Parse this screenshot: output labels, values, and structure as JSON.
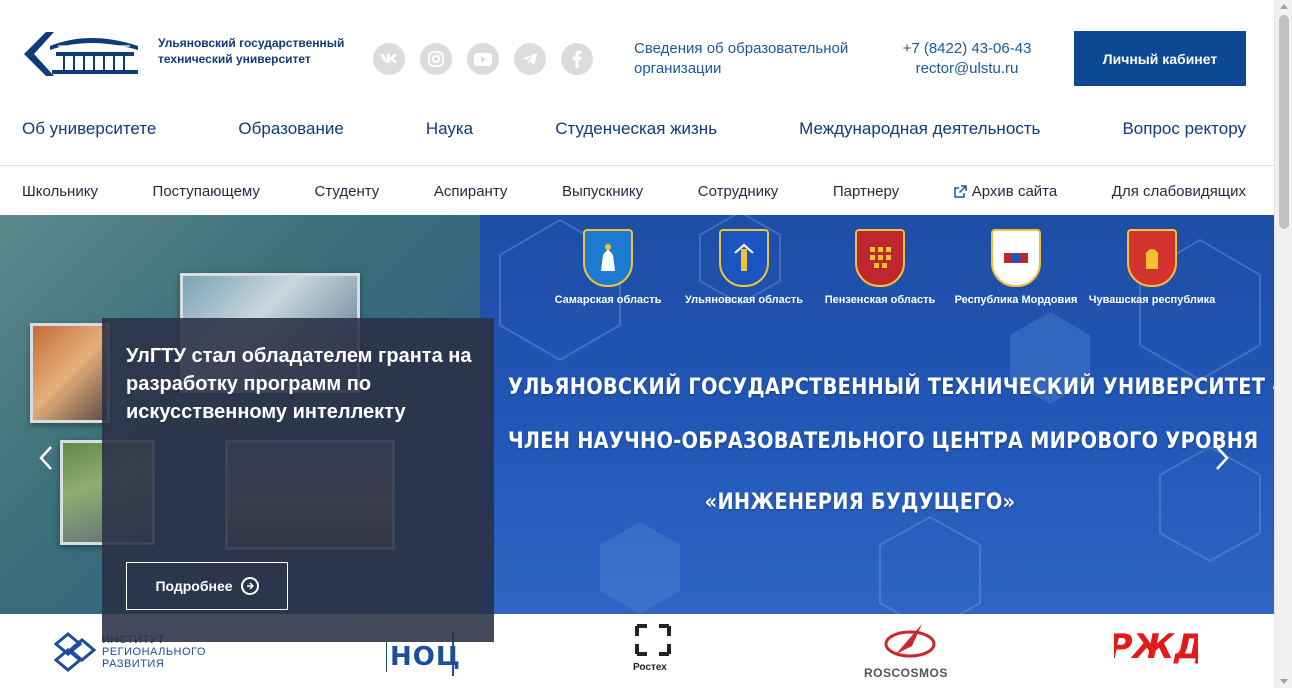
{
  "header": {
    "university_name": "Ульяновский государственный технический университет",
    "svedeniya_link": "Сведения об образовательной организации",
    "phone": "+7 (8422) 43-06-43",
    "email": "rector@ulstu.ru",
    "cabinet_button": "Личный кабинет",
    "socials": [
      "vk-icon",
      "instagram-icon",
      "youtube-icon",
      "telegram-icon",
      "facebook-icon"
    ]
  },
  "main_nav": [
    {
      "label": "Об университете"
    },
    {
      "label": "Образование"
    },
    {
      "label": "Наука"
    },
    {
      "label": "Студенческая жизнь"
    },
    {
      "label": "Международная деятельность"
    },
    {
      "label": "Вопрос ректору"
    }
  ],
  "sub_nav": [
    {
      "label": "Школьнику"
    },
    {
      "label": "Поступающему"
    },
    {
      "label": "Студенту"
    },
    {
      "label": "Аспиранту"
    },
    {
      "label": "Выпускнику"
    },
    {
      "label": "Сотруднику"
    },
    {
      "label": "Партнеру"
    },
    {
      "label": "Архив сайта",
      "icon": "external-link-icon"
    },
    {
      "label": "Для слабовидящих"
    }
  ],
  "hero": {
    "regions": [
      {
        "name": "Самарская область",
        "color": "#1d7bd1"
      },
      {
        "name": "Ульяновская область",
        "color": "#1b55c0"
      },
      {
        "name": "Пензенская область",
        "color": "#c0262d"
      },
      {
        "name": "Республика Мордовия",
        "color": "#ffffff"
      },
      {
        "name": "Чувашская республика",
        "color": "#d3342b"
      }
    ],
    "line1": "УЛЬЯНОВСКИЙ ГОСУДАРСТВЕННЫЙ ТЕХНИЧЕСКИЙ УНИВЕРСИТЕТ -",
    "line2": "ЧЛЕН НАУЧНО-ОБРАЗОВАТЕЛЬНОГО ЦЕНТРА МИРОВОГО УРОВНЯ",
    "line3": "«ИНЖЕНЕРИЯ БУДУЩЕГО»",
    "prev_arrow": "‹",
    "next_arrow": "›"
  },
  "news_card": {
    "title": "УлГТУ стал обладателем гранта на разработку программ по искусственному интеллекту",
    "more_button": "Подробнее"
  },
  "partners": {
    "irr_line1": "ИНСТИТУТ",
    "irr_line2": "РЕГИОНАЛЬНОГО",
    "irr_line3": "РАЗВИТИЯ",
    "noc": "НОЦ",
    "rostec": "Ростех",
    "roscosmos": "ROSCOSMOS",
    "rzd": "РЖД"
  },
  "colors": {
    "brand": "#0d4a93",
    "link": "#1a5a9c",
    "hero": "#2257b8",
    "rzd_red": "#e21a1a"
  }
}
